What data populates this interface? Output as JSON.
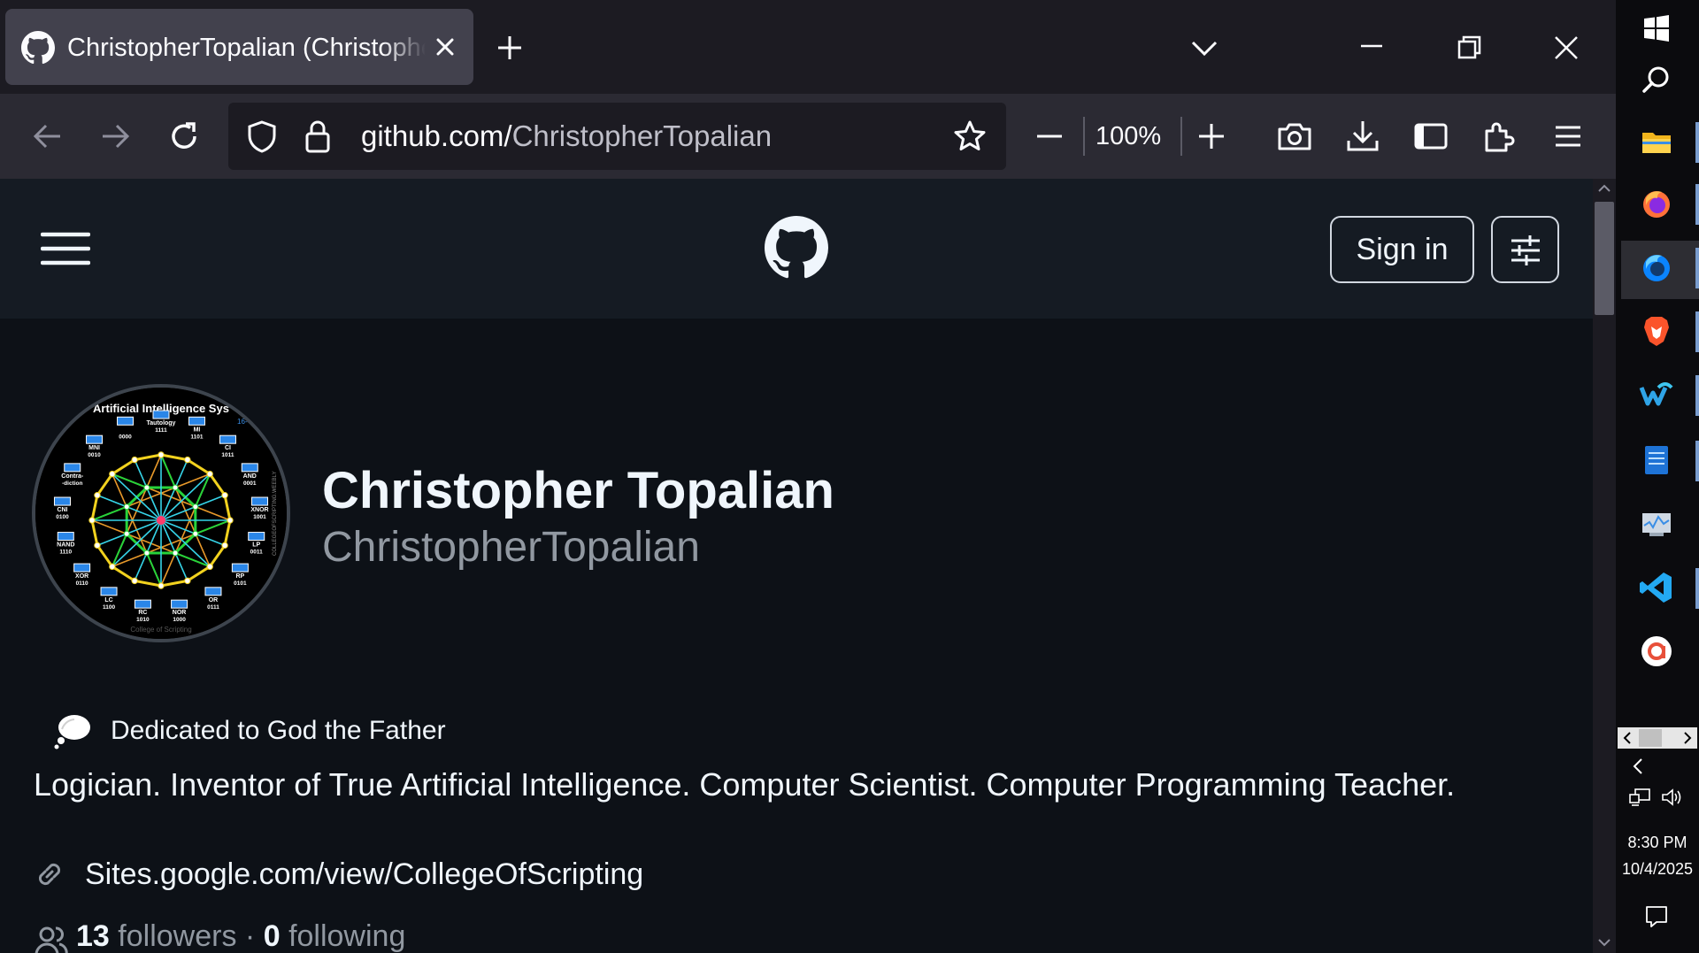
{
  "browser": {
    "tab": {
      "title": "ChristopherTopalian (Christopher Topalian)"
    },
    "url": {
      "domain": "github.com/",
      "path": "ChristopherTopalian"
    },
    "zoom": "100%"
  },
  "github_header": {
    "sign_in_label": "Sign in"
  },
  "profile": {
    "display_name": "Christopher Topalian",
    "login": "ChristopherTopalian",
    "status": "Dedicated to God the Father",
    "bio": "Logician. Inventor of True Artificial Intelligence. Computer Scientist. Computer Programming Teacher.",
    "website": "Sites.google.com/view/CollegeOfScripting",
    "followers_count": "13",
    "followers_label": "followers",
    "separator": "·",
    "following_count": "0",
    "following_label": "following",
    "avatar_text": {
      "title": "Artificial Intelligence Sys",
      "corner": "16-",
      "side": "COLLEGEOFSCRIPTING.WEEBLY",
      "footer": "College of Scripting",
      "labels": [
        {
          "name": "Tautology",
          "code": "1111"
        },
        {
          "name": "MI",
          "code": "1101"
        },
        {
          "name": "CI",
          "code": "1011"
        },
        {
          "name": "AND",
          "code": "0001"
        },
        {
          "name": "XNOR",
          "code": "1001"
        },
        {
          "name": "LP",
          "code": "0011"
        },
        {
          "name": "RP",
          "code": "0101"
        },
        {
          "name": "OR",
          "code": "0111"
        },
        {
          "name": "NOR",
          "code": "1000"
        },
        {
          "name": "RC",
          "code": "1010"
        },
        {
          "name": "LC",
          "code": "1100"
        },
        {
          "name": "XOR",
          "code": "0110"
        },
        {
          "name": "NAND",
          "code": "1110"
        },
        {
          "name": "CNI",
          "code": "0100"
        },
        {
          "name": "Contra-",
          "code": "-diction"
        },
        {
          "name": "MNI",
          "code": "0010"
        },
        {
          "name": "",
          "code": "0000"
        }
      ]
    }
  },
  "taskbar": {
    "time": "8:30 PM",
    "date": "10/4/2025"
  },
  "colors": {
    "browser_chrome": "#1c1b22",
    "toolbar": "#2b2a33",
    "active_tab": "#42414d",
    "github_header": "#151b23",
    "page_background": "#0d1117",
    "muted_text": "#9198a1"
  }
}
